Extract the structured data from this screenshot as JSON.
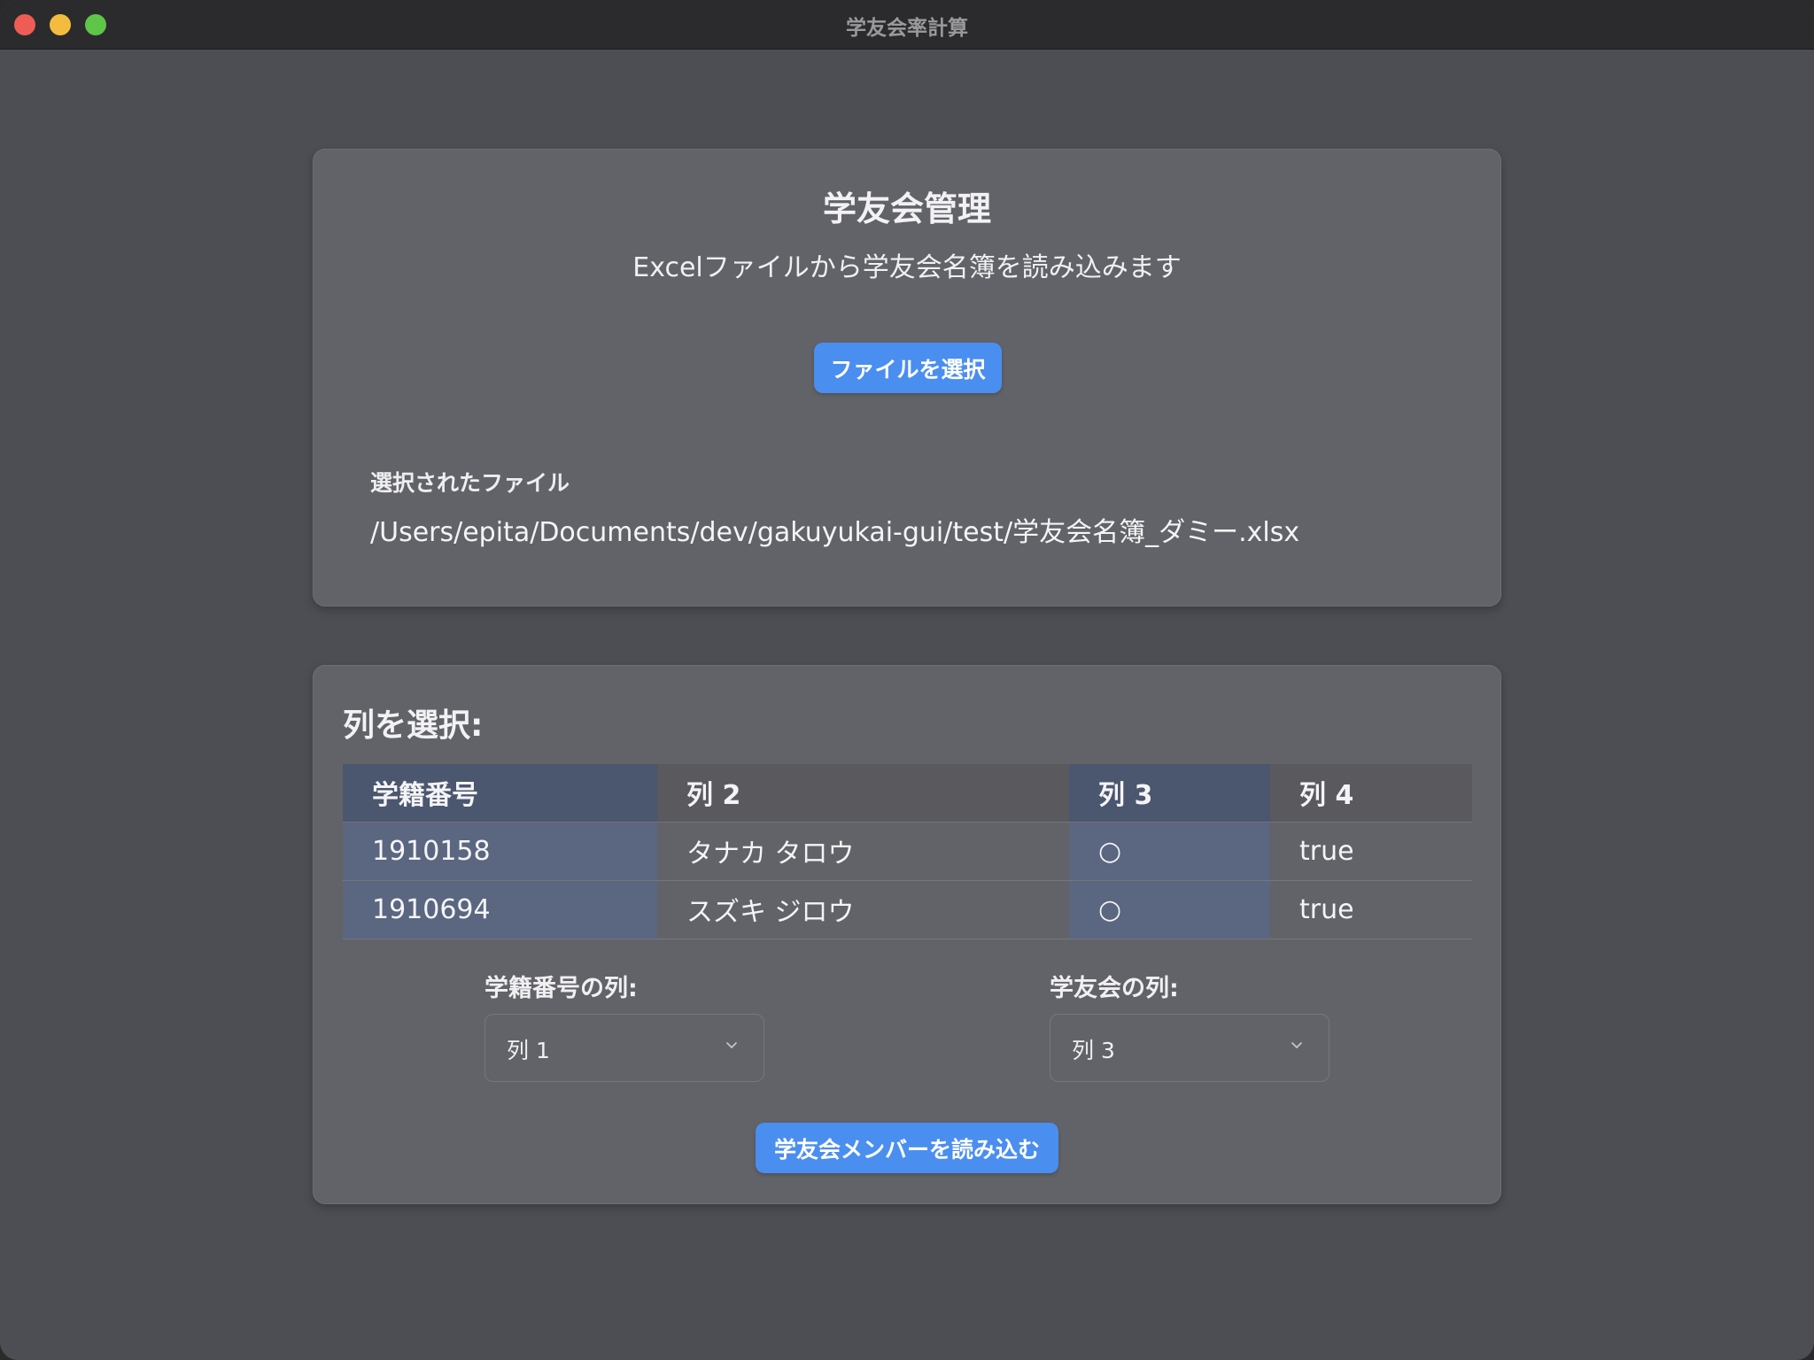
{
  "window": {
    "title": "学友会率計算"
  },
  "file_card": {
    "title": "学友会管理",
    "subtitle": "Excelファイルから学友会名簿を読み込みます",
    "select_button": "ファイルを選択",
    "selected_label": "選択されたファイル",
    "selected_path": "/Users/epita/Documents/dev/gakuyukai-gui/test/学友会名簿_ダミー.xlsx"
  },
  "column_card": {
    "heading": "列を選択:",
    "table": {
      "headers": [
        "学籍番号",
        "列 2",
        "列 3",
        "列 4"
      ],
      "rows": [
        [
          "1910158",
          "タナカ タロウ",
          "○",
          "true"
        ],
        [
          "1910694",
          "スズキ ジロウ",
          "○",
          "true"
        ]
      ]
    },
    "student_id_select": {
      "label": "学籍番号の列:",
      "value": "列 1"
    },
    "gakuyukai_select": {
      "label": "学友会の列:",
      "value": "列 3"
    },
    "load_button": "学友会メンバーを読み込む"
  },
  "colors": {
    "accent": "#4a8ef0",
    "background": "#4d4e54",
    "card": "#626368",
    "selected_column_header": "#4b566f",
    "selected_column_cell": "#5b6680"
  }
}
